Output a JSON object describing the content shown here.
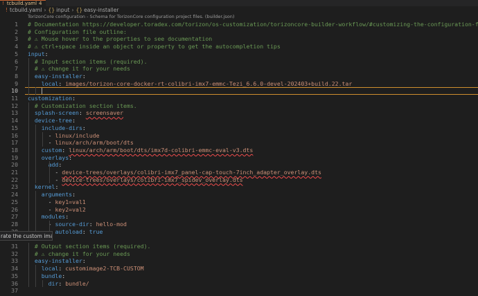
{
  "tab": {
    "bang": "!",
    "name": "tcbuild.yaml",
    "modified": "4"
  },
  "breadcrumb": {
    "bang": "!",
    "file": "tcbuild.yaml",
    "brace1": "{}",
    "seg1": "input",
    "brace2": "{}",
    "seg2": "easy-installer"
  },
  "schema_hint": "TorizonCore configuration - Schema for TorizonCore configuration project files. (builder.json)",
  "tooltip": "rate the custom image",
  "lines": [
    {
      "n": "1",
      "parts": [
        [
          "c",
          "# Documentation https://developer.toradex.com/torizon/os-customization/torizoncore-builder-workflow/#customizing-the-configuration-file"
        ]
      ]
    },
    {
      "n": "2",
      "parts": [
        [
          "c",
          "# Configuration file outline:"
        ]
      ]
    },
    {
      "n": "3",
      "parts": [
        [
          "c",
          "# ⚠ Mouse hover to the properties to see documentation"
        ]
      ]
    },
    {
      "n": "4",
      "parts": [
        [
          "c",
          "# ⚠ ctrl+space inside an object or property to get the autocompletion tips"
        ]
      ]
    },
    {
      "n": "5",
      "parts": [
        [
          "k",
          "input"
        ],
        [
          "p",
          ":"
        ]
      ]
    },
    {
      "n": "6",
      "parts": [
        [
          "p",
          "  "
        ],
        [
          "c",
          "# Input section items (required)."
        ]
      ]
    },
    {
      "n": "7",
      "parts": [
        [
          "p",
          "  "
        ],
        [
          "c",
          "# ⚠ change it for your needs"
        ]
      ]
    },
    {
      "n": "8",
      "parts": [
        [
          "p",
          "  "
        ],
        [
          "k",
          "easy-installer"
        ],
        [
          "p",
          ":"
        ]
      ]
    },
    {
      "n": "9",
      "parts": [
        [
          "p",
          "    "
        ],
        [
          "k",
          "local"
        ],
        [
          "p",
          ": "
        ],
        [
          "v",
          "images/torizon-core-docker-rt-colibri-imx7-emmc-Tezi_6.6.0-devel-202403+build.22.tar"
        ]
      ]
    },
    {
      "n": "10",
      "parts": [
        [
          "p",
          "    "
        ]
      ]
    },
    {
      "n": "11",
      "parts": [
        [
          "k",
          "customization"
        ],
        [
          "p",
          ":"
        ]
      ]
    },
    {
      "n": "12",
      "parts": [
        [
          "p",
          "  "
        ],
        [
          "c",
          "# Customization section items."
        ]
      ]
    },
    {
      "n": "13",
      "parts": [
        [
          "p",
          "  "
        ],
        [
          "k",
          "splash-screen"
        ],
        [
          "p",
          ": "
        ],
        [
          "vs",
          "screensaver"
        ]
      ]
    },
    {
      "n": "14",
      "parts": [
        [
          "p",
          "  "
        ],
        [
          "k",
          "device-tree"
        ],
        [
          "p",
          ":"
        ]
      ]
    },
    {
      "n": "15",
      "parts": [
        [
          "p",
          "    "
        ],
        [
          "k",
          "include-dirs"
        ],
        [
          "p",
          ":"
        ]
      ]
    },
    {
      "n": "16",
      "parts": [
        [
          "p",
          "      - "
        ],
        [
          "v",
          "linux/include"
        ]
      ]
    },
    {
      "n": "17",
      "parts": [
        [
          "p",
          "      - "
        ],
        [
          "v",
          "linux/arch/arm/boot/dts"
        ]
      ]
    },
    {
      "n": "18",
      "parts": [
        [
          "p",
          "    "
        ],
        [
          "k",
          "custom"
        ],
        [
          "p",
          ": "
        ],
        [
          "vs",
          "linux/arch/arm/boot/dts/imx7d-colibri-emmc-eval-v3.dts"
        ]
      ]
    },
    {
      "n": "19",
      "parts": [
        [
          "p",
          "    "
        ],
        [
          "k",
          "overlays"
        ],
        [
          "p",
          ":"
        ]
      ]
    },
    {
      "n": "20",
      "parts": [
        [
          "p",
          "      "
        ],
        [
          "k",
          "add"
        ],
        [
          "p",
          ":"
        ]
      ]
    },
    {
      "n": "21",
      "parts": [
        [
          "p",
          "        - "
        ],
        [
          "vs",
          "device-trees/overlays/colibri-imx7_panel-cap-touch-7inch_adapter_overlay.dts"
        ]
      ]
    },
    {
      "n": "22",
      "parts": [
        [
          "p",
          "        - "
        ],
        [
          "vs",
          "device-trees/overlays/colibri-imx7_spidev_overlay.dts"
        ]
      ]
    },
    {
      "n": "23",
      "parts": [
        [
          "p",
          "  "
        ],
        [
          "k",
          "kernel"
        ],
        [
          "p",
          ":"
        ]
      ]
    },
    {
      "n": "24",
      "parts": [
        [
          "p",
          "    "
        ],
        [
          "k",
          "arguments"
        ],
        [
          "p",
          ":"
        ]
      ]
    },
    {
      "n": "25",
      "parts": [
        [
          "p",
          "      - "
        ],
        [
          "v",
          "key1=val1"
        ]
      ]
    },
    {
      "n": "26",
      "parts": [
        [
          "p",
          "      - "
        ],
        [
          "v",
          "key2=val2"
        ]
      ]
    },
    {
      "n": "27",
      "parts": [
        [
          "p",
          "    "
        ],
        [
          "k",
          "modules"
        ],
        [
          "p",
          ":"
        ]
      ]
    },
    {
      "n": "28",
      "parts": [
        [
          "p",
          "      - "
        ],
        [
          "k",
          "source-dir"
        ],
        [
          "p",
          ": "
        ],
        [
          "v",
          "hello-mod"
        ]
      ]
    },
    {
      "n": "29",
      "parts": [
        [
          "p",
          "        "
        ],
        [
          "k",
          "autoload"
        ],
        [
          "p",
          ": "
        ],
        [
          "k",
          "true"
        ]
      ]
    },
    {
      "n": "30",
      "parts": []
    },
    {
      "n": "31",
      "parts": [
        [
          "p",
          "  "
        ],
        [
          "c",
          "# Output section items (required)."
        ]
      ]
    },
    {
      "n": "32",
      "parts": [
        [
          "p",
          "  "
        ],
        [
          "c",
          "# ⚠ change it for your needs"
        ]
      ]
    },
    {
      "n": "33",
      "parts": [
        [
          "p",
          "  "
        ],
        [
          "k",
          "easy-installer"
        ],
        [
          "p",
          ":"
        ]
      ]
    },
    {
      "n": "34",
      "parts": [
        [
          "p",
          "    "
        ],
        [
          "k",
          "local"
        ],
        [
          "p",
          ": "
        ],
        [
          "v",
          "customimage2-TCB-CUSTOM"
        ]
      ]
    },
    {
      "n": "35",
      "parts": [
        [
          "p",
          "    "
        ],
        [
          "k",
          "bundle"
        ],
        [
          "p",
          ":"
        ]
      ]
    },
    {
      "n": "36",
      "parts": [
        [
          "p",
          "      "
        ],
        [
          "k",
          "dir"
        ],
        [
          "p",
          ": "
        ],
        [
          "v",
          "bundle/"
        ]
      ]
    },
    {
      "n": "37",
      "parts": []
    },
    {
      "n": "38",
      "parts": []
    }
  ],
  "colors": {
    "comment": "#6a9955",
    "key": "#569cd6",
    "value": "#ce9178",
    "active_line_border": "#d08f2e",
    "tab_accent": "#cc6633"
  }
}
